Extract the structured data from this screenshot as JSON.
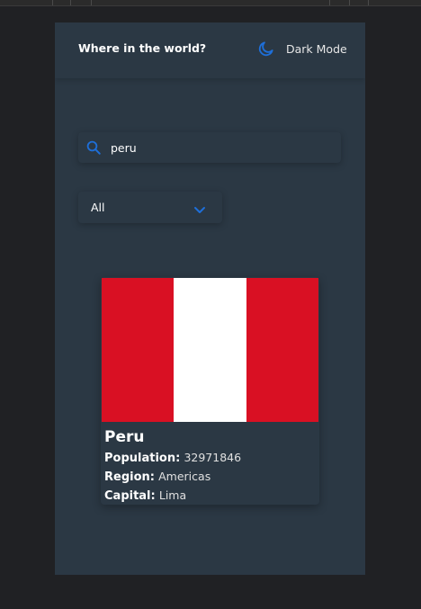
{
  "header": {
    "title": "Where in the world?",
    "theme_toggle_label": "Dark Mode",
    "theme_icon": "moon-icon"
  },
  "search": {
    "value": "peru",
    "icon": "search-icon"
  },
  "filter": {
    "selected": "All",
    "icon": "chevron-down-icon"
  },
  "countries": [
    {
      "name": "Peru",
      "population_label": "Population:",
      "population": "32971846",
      "region_label": "Region:",
      "region": "Americas",
      "capital_label": "Capital:",
      "capital": "Lima",
      "flag_colors": [
        "#d91023",
        "#ffffff",
        "#d91023"
      ]
    }
  ],
  "colors": {
    "background": "#2b3844",
    "accent": "#1e6fd9",
    "text": "#ffffff"
  }
}
